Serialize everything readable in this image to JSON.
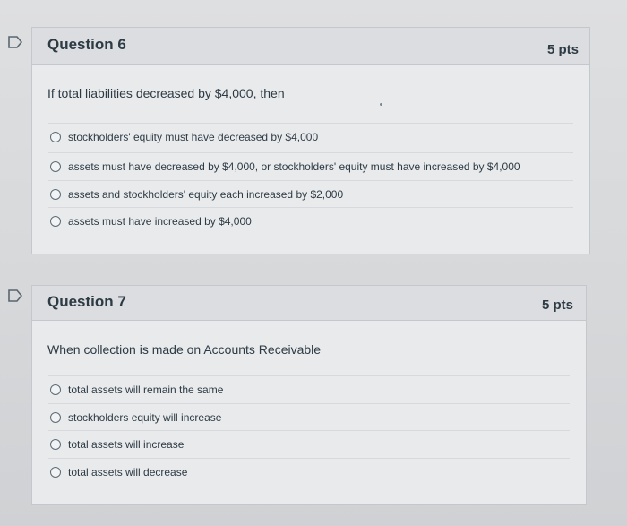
{
  "questions": [
    {
      "title": "Question 6",
      "points": "5 pts",
      "text": "If total liabilities decreased by $4,000, then",
      "answers": [
        "stockholders' equity must have decreased by $4,000",
        "assets must have decreased by $4,000, or stockholders' equity must have increased by $4,000",
        "assets and stockholders' equity each increased by $2,000",
        "assets must have increased by $4,000"
      ]
    },
    {
      "title": "Question 7",
      "points": "5 pts",
      "text": "When collection is made on Accounts Receivable",
      "answers": [
        "total assets will remain the same",
        "stockholders equity will increase",
        "total assets will increase",
        "total assets will decrease"
      ]
    }
  ],
  "colors": {
    "flag_outline": "#5a6670",
    "radio_border": "#5c6b76",
    "text": "#2d3b45"
  },
  "icons": {
    "flag": "flag-question-icon"
  }
}
